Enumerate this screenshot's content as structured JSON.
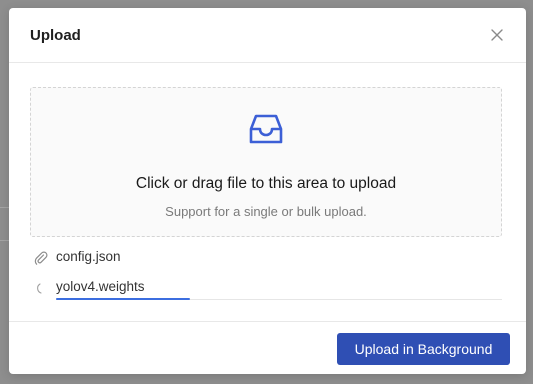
{
  "modal": {
    "title": "Upload",
    "close_icon": "close-icon"
  },
  "dropzone": {
    "icon": "inbox-icon",
    "text": "Click or drag file to this area to upload",
    "hint": "Support for a single or bulk upload.",
    "icon_color": "#3c5fd6"
  },
  "files": [
    {
      "name": "config.json",
      "icon": "paperclip-icon",
      "status": "done"
    },
    {
      "name": "yolov4.weights",
      "icon": "loading-icon",
      "status": "uploading",
      "progress_percent": 30
    }
  ],
  "footer": {
    "primary_label": "Upload in Background"
  },
  "colors": {
    "accent": "#2f4fb4",
    "progress": "#3c6ee0"
  }
}
